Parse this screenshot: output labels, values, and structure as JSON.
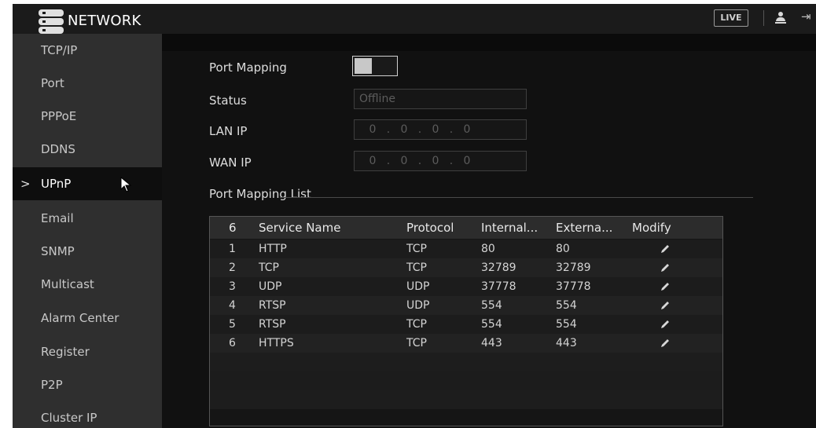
{
  "header": {
    "title": "NETWORK",
    "live_label": "LIVE"
  },
  "sidebar": {
    "items": [
      {
        "label": "TCP/IP"
      },
      {
        "label": "Port"
      },
      {
        "label": "PPPoE"
      },
      {
        "label": "DDNS"
      },
      {
        "label": "UPnP",
        "active": true
      },
      {
        "label": "Email"
      },
      {
        "label": "SNMP"
      },
      {
        "label": "Multicast"
      },
      {
        "label": "Alarm Center"
      },
      {
        "label": "Register"
      },
      {
        "label": "P2P"
      },
      {
        "label": "Cluster IP"
      }
    ],
    "active_marker": ">"
  },
  "form": {
    "port_mapping_label": "Port Mapping",
    "port_mapping_enabled": false,
    "status_label": "Status",
    "status_value": "Offline",
    "lan_ip_label": "LAN IP",
    "lan_ip": [
      "0",
      "0",
      "0",
      "0"
    ],
    "wan_ip_label": "WAN IP",
    "wan_ip": [
      "0",
      "0",
      "0",
      "0"
    ],
    "ip_separator": "."
  },
  "port_mapping_list": {
    "title": "Port Mapping List",
    "count": "6",
    "columns": [
      "Service Name",
      "Protocol",
      "Internal...",
      "Externa...",
      "Modify"
    ],
    "rows": [
      {
        "no": "1",
        "service": "HTTP",
        "protocol": "TCP",
        "internal": "80",
        "external": "80"
      },
      {
        "no": "2",
        "service": "TCP",
        "protocol": "TCP",
        "internal": "32789",
        "external": "32789"
      },
      {
        "no": "3",
        "service": "UDP",
        "protocol": "UDP",
        "internal": "37778",
        "external": "37778"
      },
      {
        "no": "4",
        "service": "RTSP",
        "protocol": "UDP",
        "internal": "554",
        "external": "554"
      },
      {
        "no": "5",
        "service": "RTSP",
        "protocol": "TCP",
        "internal": "554",
        "external": "554"
      },
      {
        "no": "6",
        "service": "HTTPS",
        "protocol": "TCP",
        "internal": "443",
        "external": "443"
      }
    ],
    "modify_icon": "pencil-icon"
  },
  "colors": {
    "main_bg": "#111111",
    "sidebar_bg": "#2f2f2f",
    "active_bg": "#0e0e0e",
    "text": "#dddddd"
  }
}
